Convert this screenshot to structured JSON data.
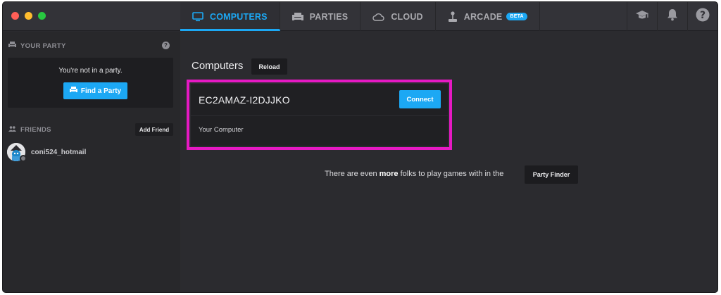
{
  "tabs": [
    {
      "label": "COMPUTERS",
      "icon": "monitor-icon"
    },
    {
      "label": "PARTIES",
      "icon": "sofa-icon"
    },
    {
      "label": "CLOUD",
      "icon": "cloud-icon"
    },
    {
      "label": "ARCADE",
      "icon": "joystick-icon",
      "badge": "BETA"
    }
  ],
  "top_icons": [
    "graduation-cap-icon",
    "bell-icon",
    "help-icon"
  ],
  "sidebar": {
    "party_section": {
      "title": "YOUR PARTY",
      "help": "?",
      "empty_text": "You're not in a party.",
      "find_party_label": "Find a Party"
    },
    "friends_section": {
      "title": "FRIENDS",
      "add_friend_label": "Add Friend",
      "friends": [
        {
          "name": "coni524_hotmail",
          "status": "offline"
        }
      ]
    }
  },
  "main": {
    "title": "Computers",
    "reload_label": "Reload",
    "computer": {
      "name": "EC2AMAZ-I2DJJKO",
      "connect_label": "Connect",
      "subtitle": "Your Computer"
    },
    "finder": {
      "text_before": "There are even ",
      "text_bold": "more",
      "text_after": " folks to play games with in the",
      "button_label": "Party Finder"
    }
  },
  "colors": {
    "accent": "#1ca8f4",
    "highlight": "#e619c3",
    "background": "#2b2b2f",
    "sidebar": "#28282b"
  }
}
